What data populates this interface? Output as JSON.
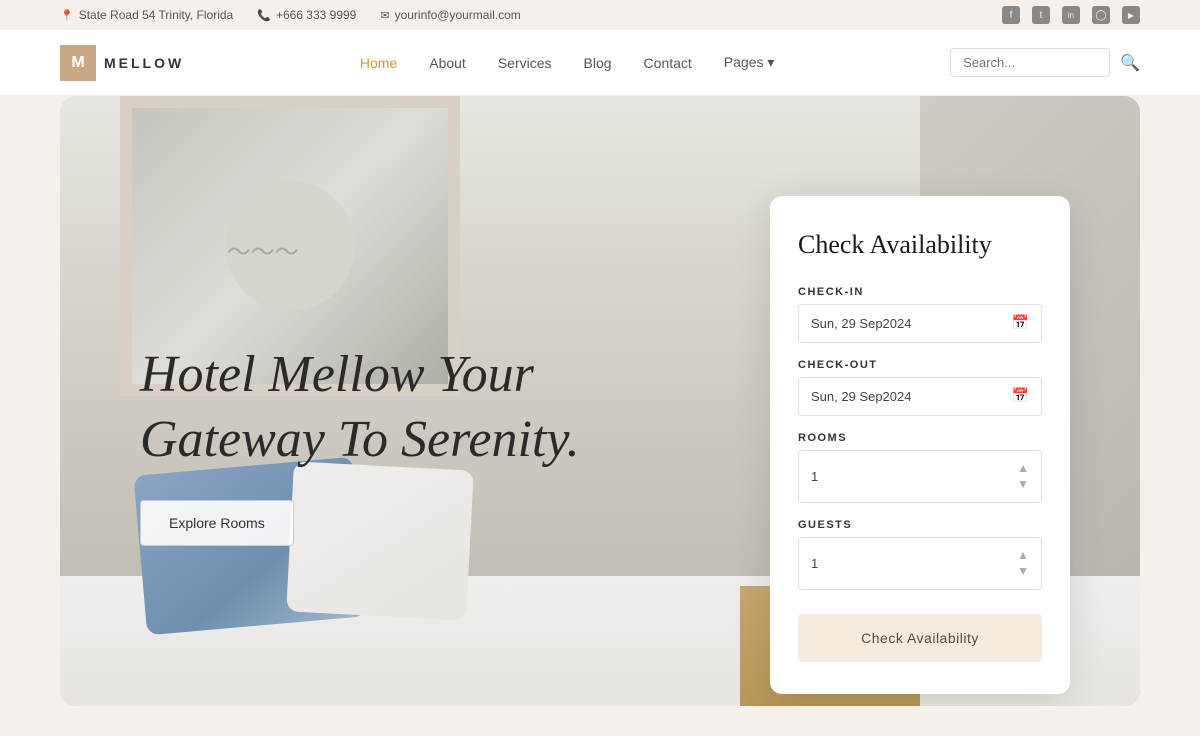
{
  "topbar": {
    "address": "State Road 54 Trinity, Florida",
    "phone": "+666 333 9999",
    "email": "yourinfo@yourmail.com",
    "social": [
      {
        "name": "facebook",
        "icon": "f"
      },
      {
        "name": "twitter",
        "icon": "t"
      },
      {
        "name": "linkedin",
        "icon": "in"
      },
      {
        "name": "instagram",
        "icon": "◯"
      },
      {
        "name": "youtube",
        "icon": "▶"
      }
    ]
  },
  "navbar": {
    "logo_text": "MELLOW",
    "links": [
      {
        "label": "Home",
        "active": true
      },
      {
        "label": "About",
        "active": false
      },
      {
        "label": "Services",
        "active": false
      },
      {
        "label": "Blog",
        "active": false
      },
      {
        "label": "Contact",
        "active": false
      },
      {
        "label": "Pages ▾",
        "active": false
      }
    ],
    "search_placeholder": "Search..."
  },
  "hero": {
    "title_line1": "Hotel Mellow Your",
    "title_line2": "Gateway To Serenity.",
    "explore_btn": "Explore Rooms"
  },
  "availability": {
    "card_title": "Check Availability",
    "checkin_label": "CHECK-IN",
    "checkin_value": "Sun, 29 Sep2024",
    "checkout_label": "CHECK-OUT",
    "checkout_value": "Sun, 29 Sep2024",
    "rooms_label": "ROOMS",
    "rooms_value": "1",
    "guests_label": "GUESTS",
    "guests_value": "1",
    "cta_label": "Check Availability"
  }
}
